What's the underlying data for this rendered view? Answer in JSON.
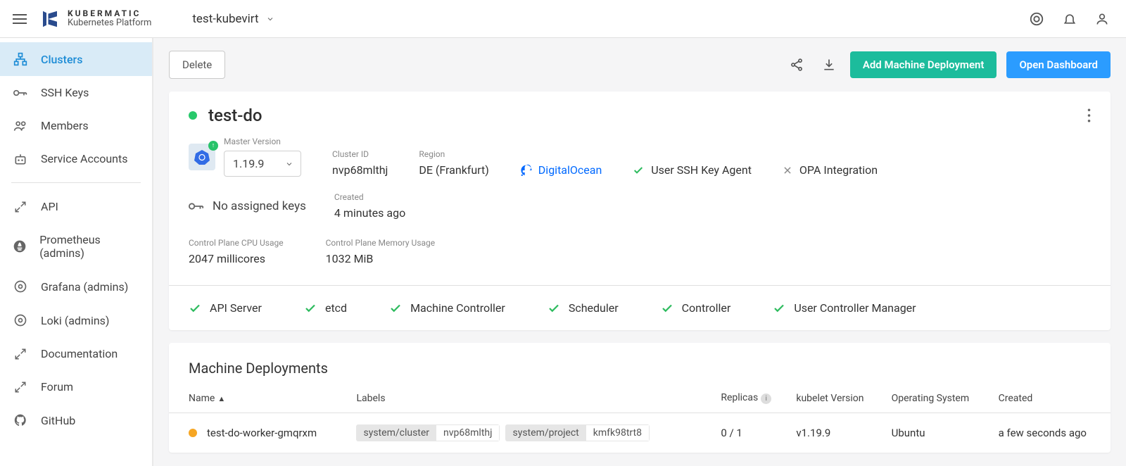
{
  "brand": {
    "top": "KUBERMATIC",
    "bottom": "Kubernetes Platform"
  },
  "project": "test-kubevirt",
  "sidebar": {
    "items": [
      {
        "label": "Clusters"
      },
      {
        "label": "SSH Keys"
      },
      {
        "label": "Members"
      },
      {
        "label": "Service Accounts"
      },
      {
        "label": "API"
      },
      {
        "label": "Prometheus (admins)"
      },
      {
        "label": "Grafana (admins)"
      },
      {
        "label": "Loki (admins)"
      },
      {
        "label": "Documentation"
      },
      {
        "label": "Forum"
      },
      {
        "label": "GitHub"
      }
    ]
  },
  "actions": {
    "delete": "Delete",
    "addMD": "Add Machine Deployment",
    "openDash": "Open Dashboard"
  },
  "cluster": {
    "name": "test-do",
    "masterVersionLabel": "Master Version",
    "masterVersion": "1.19.9",
    "clusterIdLabel": "Cluster ID",
    "clusterId": "nvp68mlthj",
    "regionLabel": "Region",
    "region": "DE (Frankfurt)",
    "provider": "DigitalOcean",
    "sshAgent": "User SSH Key Agent",
    "opa": "OPA Integration",
    "sshKeys": "No assigned keys",
    "createdLabel": "Created",
    "created": "4 minutes ago",
    "cpuLabel": "Control Plane CPU Usage",
    "cpu": "2047 millicores",
    "memLabel": "Control Plane Memory Usage",
    "mem": "1032 MiB",
    "components": [
      "API Server",
      "etcd",
      "Machine Controller",
      "Scheduler",
      "Controller",
      "User Controller Manager"
    ]
  },
  "md": {
    "title": "Machine Deployments",
    "cols": {
      "name": "Name",
      "labels": "Labels",
      "replicas": "Replicas",
      "kubelet": "kubelet Version",
      "os": "Operating System",
      "created": "Created"
    },
    "rows": [
      {
        "name": "test-do-worker-gmqrxm",
        "labels": [
          {
            "k": "system/cluster",
            "v": "nvp68mlthj"
          },
          {
            "k": "system/project",
            "v": "kmfk98trt8"
          }
        ],
        "replicas": "0 / 1",
        "kubelet": "v1.19.9",
        "os": "Ubuntu",
        "created": "a few seconds ago"
      }
    ]
  }
}
